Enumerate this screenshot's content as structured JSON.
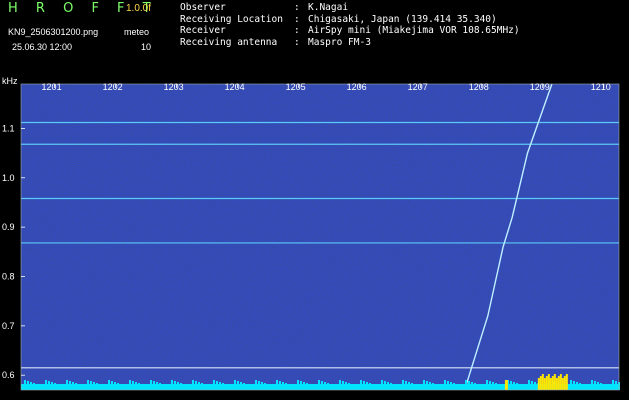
{
  "header": {
    "logo": "H R O F F T",
    "version": "1.0.0f",
    "filename": "KN9_2506301200.png",
    "timestamp": "25.06.30 12:00",
    "meteo_label": "meteo",
    "meteo_value": "10",
    "info": [
      {
        "label": "Observer",
        "value": "K.Nagai"
      },
      {
        "label": "Receiving Location",
        "value": "Chigasaki, Japan (139.414 35.340)"
      },
      {
        "label": "Receiver",
        "value": "AirSpy mini (Miakejima VOR 108.65MHz)"
      },
      {
        "label": "Receiving antenna",
        "value": "Maspro FM-3"
      }
    ]
  },
  "chart_data": {
    "type": "heatmap",
    "ylabel": "kHz",
    "x_ticks": [
      "1201",
      "1202",
      "1203",
      "1204",
      "1205",
      "1206",
      "1207",
      "1208",
      "1209",
      "1210"
    ],
    "y_ticks": [
      "1.1",
      "1.0",
      "0.9",
      "0.8",
      "0.7",
      "0.6"
    ],
    "ylim": [
      0.57,
      1.19
    ],
    "horizontal_lines_khz": [
      1.112,
      1.068,
      0.958,
      0.868,
      0.615
    ],
    "trace": [
      [
        1207.72,
        0.57
      ],
      [
        1208.1,
        0.72
      ],
      [
        1208.35,
        0.86
      ],
      [
        1208.5,
        0.92
      ],
      [
        1208.75,
        1.05
      ],
      [
        1209.15,
        1.19
      ]
    ],
    "colors": {
      "background": "#0a0f7a",
      "line": "#5fd8ff",
      "trace": "#bff0ff",
      "level": "#00e5ff",
      "burst": "#ffe600"
    }
  }
}
